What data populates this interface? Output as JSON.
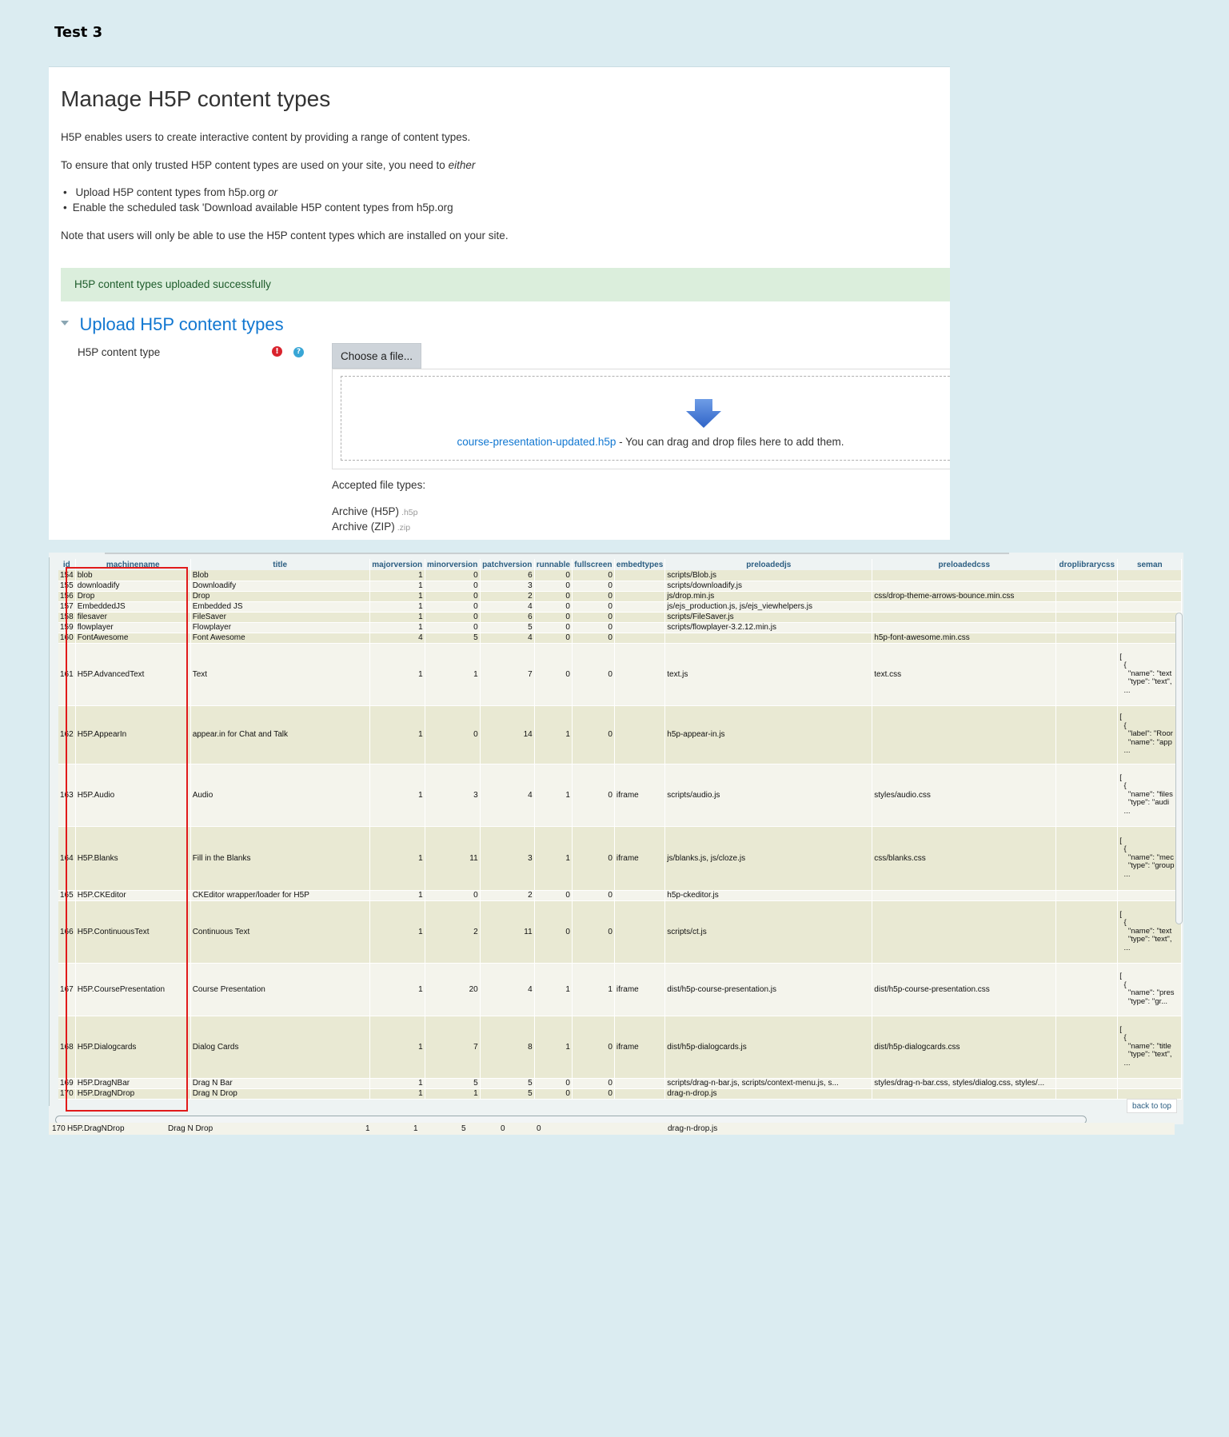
{
  "doc": {
    "title": "Test 3"
  },
  "moodle": {
    "heading": "Manage H5P content types",
    "intro": "H5P enables users to create interactive content by providing a range of content types.",
    "trusted_prefix": "To ensure that only trusted H5P content types are used on your site, you need to",
    "trusted_emph": "either",
    "bullet1": "Upload H5P content types from h5p.org",
    "bullet1_emph": "or",
    "bullet2": "Enable the scheduled task 'Download available H5P content types from h5p.org",
    "note": "Note that users will only be able to use the H5P content types which are installed on your site.",
    "alert": "H5P content types uploaded successfully",
    "section_title": "Upload H5P content types",
    "field_label": "H5P content type",
    "required_icon": "!",
    "help_icon": "?",
    "choose_button": "Choose a file...",
    "file_link": "course-presentation-updated.h5p",
    "drop_hint": " - You can drag and drop files here to add them.",
    "accepted_label": "Accepted file types:",
    "file_types": [
      {
        "name": "Archive (H5P)",
        "ext": ".h5p"
      },
      {
        "name": "Archive (ZIP)",
        "ext": ".zip"
      }
    ]
  },
  "db": {
    "columns": [
      "id",
      "machinename",
      "title",
      "majorversion",
      "minorversion",
      "patchversion",
      "runnable",
      "fullscreen",
      "embedtypes",
      "preloadedjs",
      "preloadedcss",
      "droplibrarycss",
      "seman"
    ],
    "rows": [
      [
        "154",
        "blob",
        "Blob",
        "1",
        "0",
        "6",
        "0",
        "0",
        "",
        "scripts/Blob.js",
        "",
        "",
        ""
      ],
      [
        "155",
        "downloadify",
        "Downloadify",
        "1",
        "0",
        "3",
        "0",
        "0",
        "",
        "scripts/downloadify.js",
        "",
        "",
        ""
      ],
      [
        "156",
        "Drop",
        "Drop",
        "1",
        "0",
        "2",
        "0",
        "0",
        "",
        "js/drop.min.js",
        "css/drop-theme-arrows-bounce.min.css",
        "",
        ""
      ],
      [
        "157",
        "EmbeddedJS",
        "Embedded JS",
        "1",
        "0",
        "4",
        "0",
        "0",
        "",
        "js/ejs_production.js, js/ejs_viewhelpers.js",
        "",
        "",
        ""
      ],
      [
        "158",
        "filesaver",
        "FileSaver",
        "1",
        "0",
        "6",
        "0",
        "0",
        "",
        "scripts/FileSaver.js",
        "",
        "",
        ""
      ],
      [
        "159",
        "flowplayer",
        "Flowplayer",
        "1",
        "0",
        "5",
        "0",
        "0",
        "",
        "scripts/flowplayer-3.2.12.min.js",
        "",
        "",
        ""
      ],
      [
        "160",
        "FontAwesome",
        "Font Awesome",
        "4",
        "5",
        "4",
        "0",
        "0",
        "",
        "",
        "h5p-font-awesome.min.css",
        "",
        ""
      ],
      [
        "161",
        "H5P.AdvancedText",
        "Text",
        "1",
        "1",
        "7",
        "0",
        "0",
        "",
        "text.js",
        "text.css",
        "",
        "[\n  {\n    \"name\": \"text\n    \"type\": \"text\",\n  ..."
      ],
      [
        "162",
        "H5P.AppearIn",
        "appear.in for Chat and Talk",
        "1",
        "0",
        "14",
        "1",
        "0",
        "",
        "h5p-appear-in.js",
        "",
        "",
        "[\n  {\n    \"label\": \"Roor\n    \"name\": \"app\n  ..."
      ],
      [
        "163",
        "H5P.Audio",
        "Audio",
        "1",
        "3",
        "4",
        "1",
        "0",
        "iframe",
        "scripts/audio.js",
        "styles/audio.css",
        "",
        "[\n  {\n    \"name\": \"files\n    \"type\": \"audi\n  ..."
      ],
      [
        "164",
        "H5P.Blanks",
        "Fill in the Blanks",
        "1",
        "11",
        "3",
        "1",
        "0",
        "iframe",
        "js/blanks.js, js/cloze.js",
        "css/blanks.css",
        "",
        "[\n  {\n    \"name\": \"mec\n    \"type\": \"group\n  ..."
      ],
      [
        "165",
        "H5P.CKEditor",
        "CKEditor wrapper/loader for H5P",
        "1",
        "0",
        "2",
        "0",
        "0",
        "",
        "h5p-ckeditor.js",
        "",
        "",
        ""
      ],
      [
        "166",
        "H5P.ContinuousText",
        "Continuous Text",
        "1",
        "2",
        "11",
        "0",
        "0",
        "",
        "scripts/ct.js",
        "",
        "",
        "[\n  {\n    \"name\": \"text\n    \"type\": \"text\",\n  ..."
      ],
      [
        "167",
        "H5P.CoursePresentation",
        "Course Presentation",
        "1",
        "20",
        "4",
        "1",
        "1",
        "iframe",
        "dist/h5p-course-presentation.js",
        "dist/h5p-course-presentation.css",
        "",
        "[\n  {\n    \"name\": \"pres\n    \"type\": \"gr..."
      ],
      [
        "168",
        "H5P.Dialogcards",
        "Dialog Cards",
        "1",
        "7",
        "8",
        "1",
        "0",
        "iframe",
        "dist/h5p-dialogcards.js",
        "dist/h5p-dialogcards.css",
        "",
        "[\n  {\n    \"name\": \"title\n    \"type\": \"text\",\n  ..."
      ],
      [
        "169",
        "H5P.DragNBar",
        "Drag N Bar",
        "1",
        "5",
        "5",
        "0",
        "0",
        "",
        "scripts/drag-n-bar.js, scripts/context-menu.js, s...",
        "styles/drag-n-bar.css, styles/dialog.css, styles/...",
        "",
        ""
      ],
      [
        "170",
        "H5P.DragNDrop",
        "Drag N Drop",
        "1",
        "1",
        "5",
        "0",
        "0",
        "",
        "drag-n-drop.js",
        "",
        "",
        ""
      ]
    ],
    "back_to_top": "back to top",
    "ghost_row": [
      "170",
      "H5P.DragNDrop",
      "Drag N Drop",
      "1",
      "1",
      "5",
      "0",
      "0",
      "drag-n-drop.js"
    ]
  }
}
